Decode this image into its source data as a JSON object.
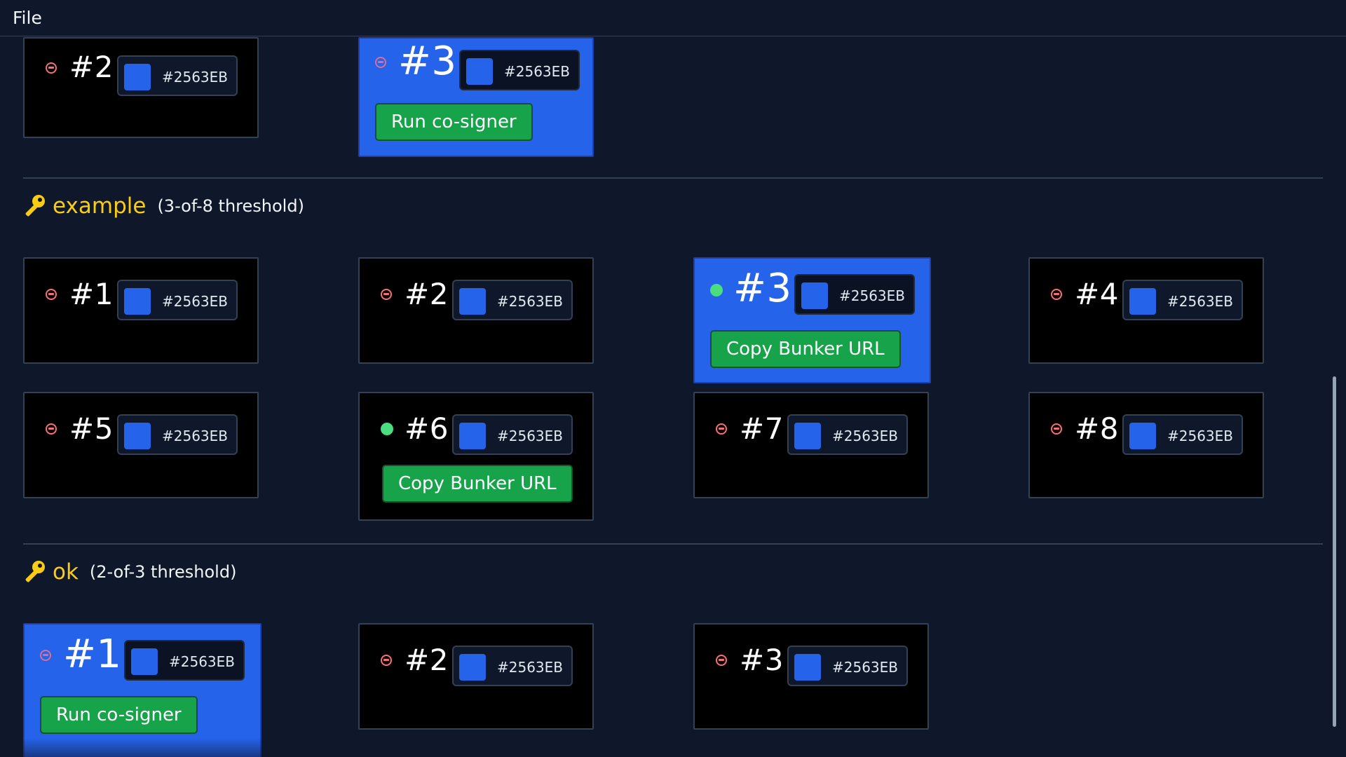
{
  "menubar": {
    "file_label": "File"
  },
  "colors": {
    "background": "#0f172a",
    "active_card": "#2563EB",
    "online": "#4ade80",
    "offline": "#f87171",
    "key": "#facc15",
    "button": "#16a34a"
  },
  "icons": {
    "group_key": "key-icon",
    "offline_status": "minus-circle-icon",
    "online_status": "online-dot-icon"
  },
  "top_group": {
    "cards": [
      {
        "number": "#2",
        "color": "#2563EB",
        "status": "offline",
        "active": false
      },
      {
        "number": "#3",
        "color": "#2563EB",
        "status": "offline",
        "active": true,
        "button": "Run co-signer"
      }
    ]
  },
  "groups": [
    {
      "name": "example",
      "threshold": "(3-of-8 threshold)",
      "cards": [
        {
          "number": "#1",
          "color": "#2563EB",
          "status": "offline",
          "active": false
        },
        {
          "number": "#2",
          "color": "#2563EB",
          "status": "offline",
          "active": false
        },
        {
          "number": "#3",
          "color": "#2563EB",
          "status": "online",
          "active": true,
          "button": "Copy Bunker URL"
        },
        {
          "number": "#4",
          "color": "#2563EB",
          "status": "offline",
          "active": false
        },
        {
          "number": "#5",
          "color": "#2563EB",
          "status": "offline",
          "active": false
        },
        {
          "number": "#6",
          "color": "#2563EB",
          "status": "online",
          "active": false,
          "button": "Copy Bunker URL"
        },
        {
          "number": "#7",
          "color": "#2563EB",
          "status": "offline",
          "active": false
        },
        {
          "number": "#8",
          "color": "#2563EB",
          "status": "offline",
          "active": false
        }
      ]
    },
    {
      "name": "ok",
      "threshold": "(2-of-3 threshold)",
      "cards": [
        {
          "number": "#1",
          "color": "#2563EB",
          "status": "offline",
          "active": true,
          "button": "Run co-signer"
        },
        {
          "number": "#2",
          "color": "#2563EB",
          "status": "offline",
          "active": false
        },
        {
          "number": "#3",
          "color": "#2563EB",
          "status": "offline",
          "active": false
        }
      ]
    }
  ]
}
